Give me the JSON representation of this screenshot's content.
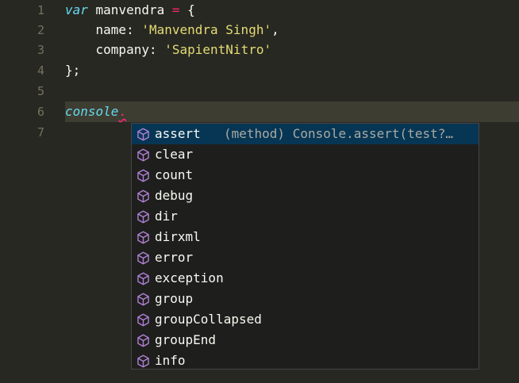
{
  "editor": {
    "line_numbers": [
      "1",
      "2",
      "3",
      "4",
      "5",
      "6",
      "7"
    ],
    "line1": {
      "keyword": "var",
      "name": " manvendra ",
      "eq": "=",
      "brace": " {"
    },
    "line2": {
      "indent": "    ",
      "key": "name",
      "colon": ": ",
      "value": "'Manvendra Singh'",
      "comma": ","
    },
    "line3": {
      "indent": "    ",
      "key": "company",
      "colon": ": ",
      "value": "'SapientNitro'"
    },
    "line4": {
      "text": "};"
    },
    "line6": {
      "object": "console",
      "dot": "."
    }
  },
  "suggest": {
    "icon": "method-cube-icon",
    "items": [
      {
        "label": "assert",
        "detail": "(method) Console.assert(test?…"
      },
      {
        "label": "clear"
      },
      {
        "label": "count"
      },
      {
        "label": "debug"
      },
      {
        "label": "dir"
      },
      {
        "label": "dirxml"
      },
      {
        "label": "error"
      },
      {
        "label": "exception"
      },
      {
        "label": "group"
      },
      {
        "label": "groupCollapsed"
      },
      {
        "label": "groupEnd"
      },
      {
        "label": "info"
      }
    ]
  },
  "colors": {
    "background": "#272822",
    "selection": "#073655",
    "icon": "#b180d7"
  }
}
